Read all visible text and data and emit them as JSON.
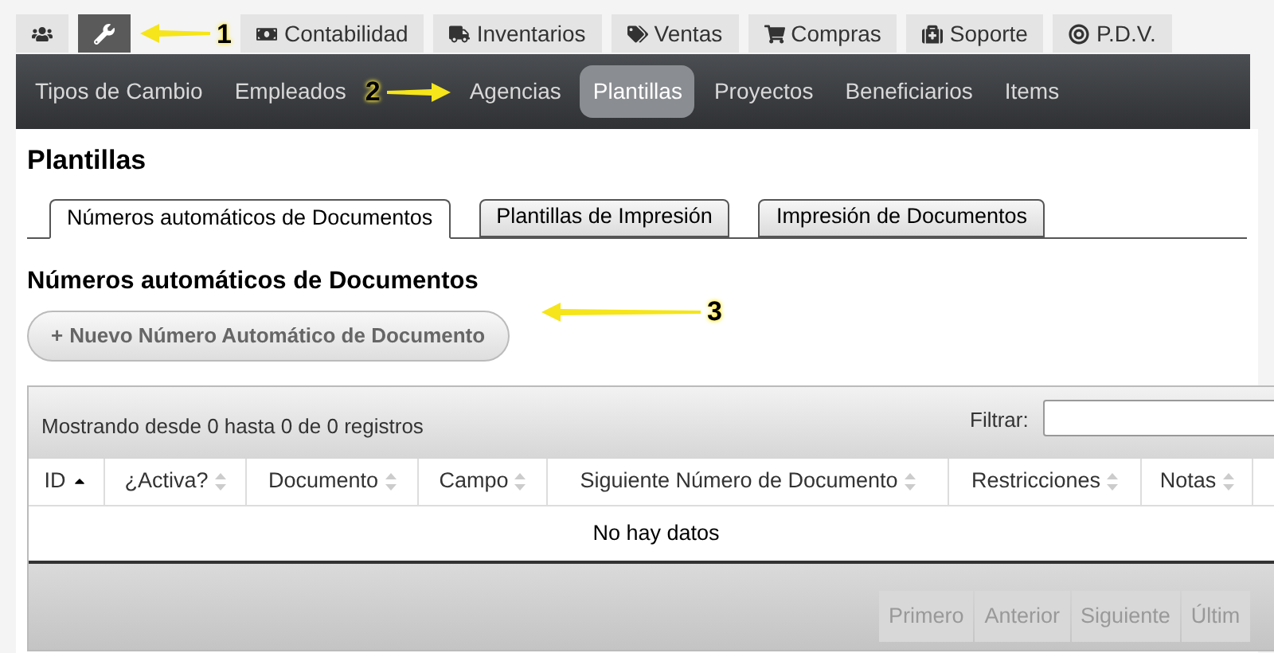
{
  "top_tabs": [
    {
      "selected": false
    },
    {
      "selected": true
    },
    {
      "label": "Contabilidad",
      "selected": false
    },
    {
      "label": "Inventarios",
      "selected": false
    },
    {
      "label": "Ventas",
      "selected": false
    },
    {
      "label": "Compras",
      "selected": false
    },
    {
      "label": "Soporte",
      "selected": false
    },
    {
      "label": "P.D.V.",
      "selected": false
    }
  ],
  "nav": [
    {
      "label": "Tipos de Cambio",
      "selected": false
    },
    {
      "label": "Empleados",
      "selected": false
    },
    {
      "label": "Agencias",
      "selected": false
    },
    {
      "label": "Plantillas",
      "selected": true
    },
    {
      "label": "Proyectos",
      "selected": false
    },
    {
      "label": "Beneficiarios",
      "selected": false
    },
    {
      "label": "Items",
      "selected": false
    }
  ],
  "page_title": "Plantillas",
  "tabs": [
    {
      "label": "Números automáticos de Documentos",
      "selected": true
    },
    {
      "label": "Plantillas de Impresión",
      "selected": false
    },
    {
      "label": "Impresión de Documentos",
      "selected": false
    }
  ],
  "section_title": "Números automáticos de Documentos",
  "new_button": {
    "icon": "+",
    "label": "Nuevo Número Automático de Documento"
  },
  "table": {
    "info": "Mostrando desde 0 hasta 0 de 0 registros",
    "filter_label": "Filtrar:",
    "columns": [
      {
        "label": "ID",
        "sorted": true
      },
      {
        "label": "¿Activa?",
        "sorted": false
      },
      {
        "label": "Documento",
        "sorted": false
      },
      {
        "label": "Campo",
        "sorted": false
      },
      {
        "label": "Siguiente Número de Documento",
        "sorted": false
      },
      {
        "label": "Restricciones",
        "sorted": false
      },
      {
        "label": "Notas",
        "sorted": false
      }
    ],
    "empty": "No hay datos",
    "pagination": [
      {
        "label": "Primero",
        "disabled": true
      },
      {
        "label": "Anterior",
        "disabled": true
      },
      {
        "label": "Siguiente",
        "disabled": true
      },
      {
        "label": "Últim",
        "disabled": true
      }
    ]
  },
  "annotations": [
    {
      "label": "1"
    },
    {
      "label": "2"
    },
    {
      "label": "3"
    }
  ]
}
